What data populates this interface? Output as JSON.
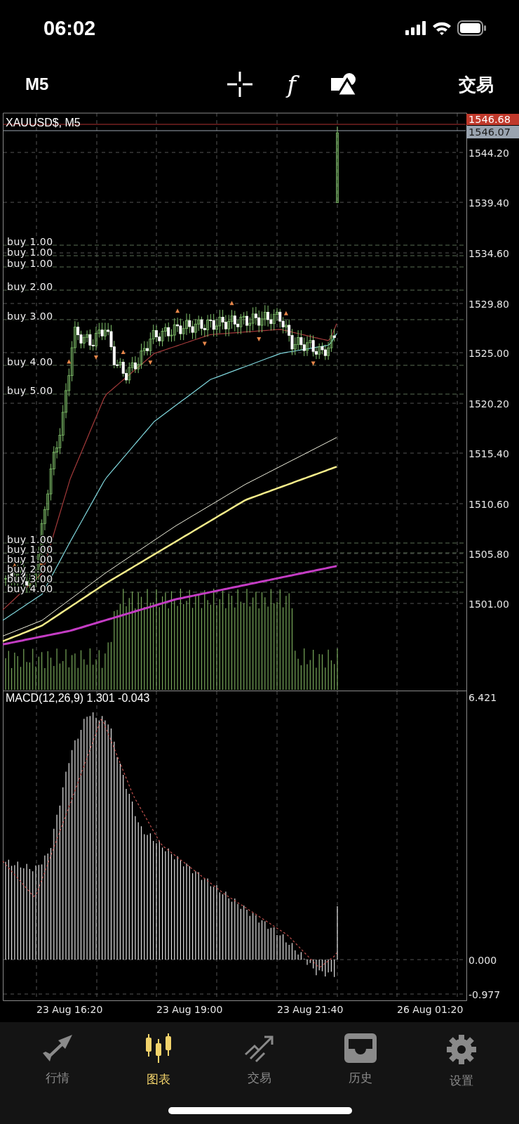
{
  "status_bar": {
    "time": "06:02"
  },
  "toolbar": {
    "timeframe": "M5",
    "function_symbol": "f",
    "trade": "交易"
  },
  "chart": {
    "symbol": "XAUUSD$, M5",
    "ask_price": "1546.68",
    "current_price": "1546.07",
    "price_labels": [
      "1544.20",
      "1539.40",
      "1534.60",
      "1529.80",
      "1525.00",
      "1520.20",
      "1515.40",
      "1510.60",
      "1505.80",
      "1501.00"
    ],
    "orders": [
      {
        "label": "buy 1.00"
      },
      {
        "label": "buy 1.00"
      },
      {
        "label": "buy 1.00"
      },
      {
        "label": "buy 2.00"
      },
      {
        "label": "buy 3.00"
      },
      {
        "label": "buy 4.00"
      },
      {
        "label": "buy 5.00"
      },
      {
        "label": "buy 1.00"
      },
      {
        "label": "buy 1.00"
      },
      {
        "label": "buy 1.00"
      },
      {
        "label": "buy 2.00"
      },
      {
        "label": "buy 3.00"
      },
      {
        "label": "buy 4.00"
      }
    ]
  },
  "macd": {
    "label": "MACD(12,26,9) 1.301 -0.043",
    "axis_labels": [
      "6.421",
      "0.000",
      "-0.977"
    ]
  },
  "time_labels": [
    "23 Aug 16:20",
    "23 Aug 19:00",
    "23 Aug 21:40",
    "26 Aug 01:20"
  ],
  "tabs": [
    {
      "label": "行情",
      "kind": "quotes",
      "selected": false
    },
    {
      "label": "图表",
      "kind": "chart",
      "selected": true
    },
    {
      "label": "交易",
      "kind": "trade",
      "selected": false
    },
    {
      "label": "历史",
      "kind": "history",
      "selected": false
    },
    {
      "label": "设置",
      "kind": "settings",
      "selected": false
    }
  ]
}
